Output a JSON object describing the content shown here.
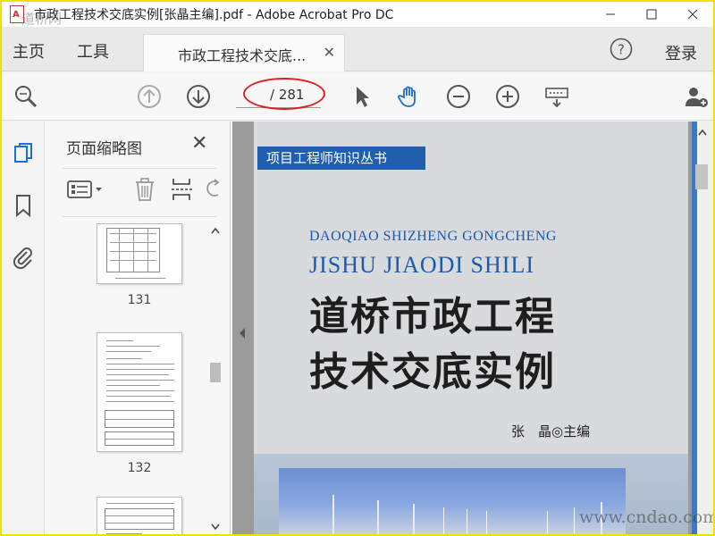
{
  "window": {
    "title": "市政工程技术交底实例[张晶主编].pdf - Adobe Acrobat Pro DC",
    "watermark_top_left": "道桥网"
  },
  "tabs": {
    "home": "主页",
    "tools": "工具",
    "document_tab": "市政工程技术交底...",
    "login": "登录"
  },
  "toolbar": {
    "page_current": "",
    "page_total": "/ 281"
  },
  "thumbnails_panel": {
    "title": "页面缩略图",
    "pages": [
      {
        "label": "131"
      },
      {
        "label": "132"
      }
    ]
  },
  "document": {
    "series_banner": "项目工程师知识丛书",
    "pinyin_line1": "DAOQIAO SHIZHENG GONGCHENG",
    "pinyin_line2": "JISHU JIAODI SHILI",
    "title_line1": "道桥市政工程",
    "title_line2": "技术交底实例",
    "author": "张　晶◎主编"
  },
  "watermark_bottom_right": "www.cndao.com",
  "colors": {
    "border_yellow": "#f4e000",
    "banner_blue": "#1f5fae",
    "pinyin_blue": "#1a5bb0",
    "annotation_red": "#e02020"
  }
}
